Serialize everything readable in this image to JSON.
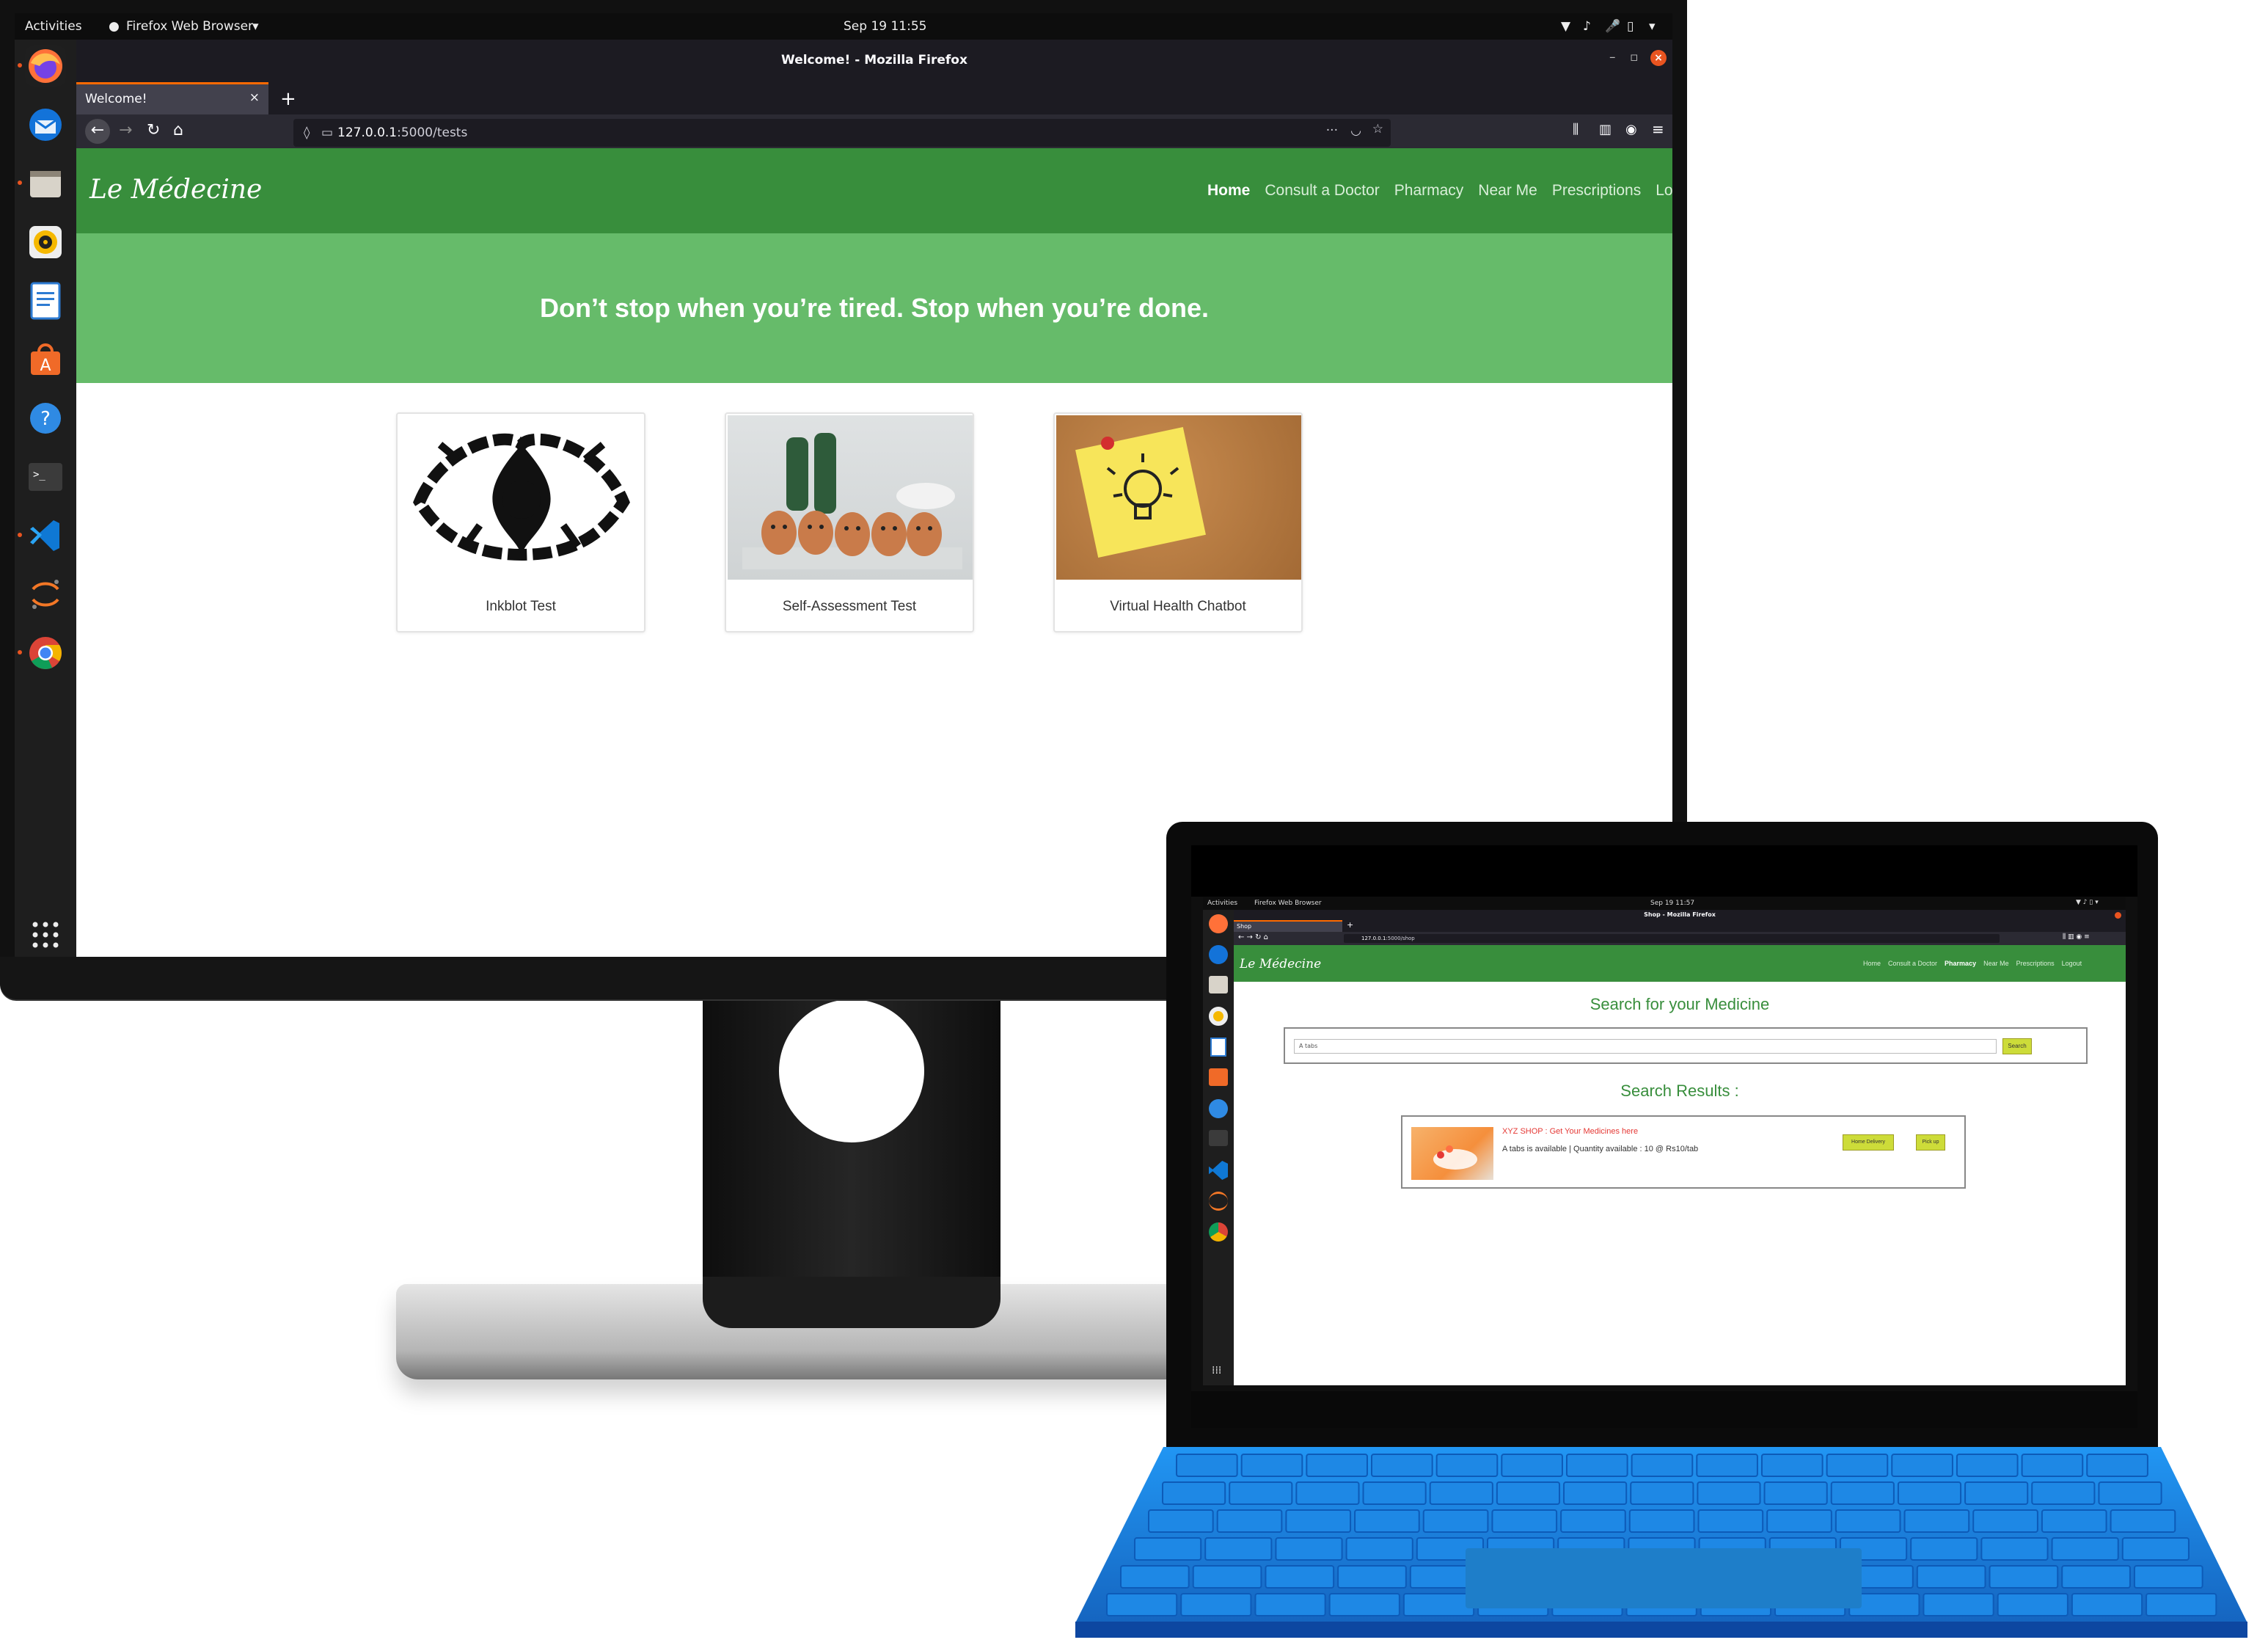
{
  "desktop": {
    "activities": "Activities",
    "app_menu": "Firefox Web Browser",
    "clock": "Sep 19  11:55",
    "window_title": "Welcome! - Mozilla Firefox",
    "tab_title": "Welcome!",
    "url_host": "127.0.0.1",
    "url_path": ":5000/tests",
    "dock": [
      "firefox-icon",
      "thunderbird-icon",
      "files-icon",
      "rhythmbox-icon",
      "writer-icon",
      "software-icon",
      "help-icon",
      "terminal-icon",
      "vscode-icon",
      "jupyter-icon",
      "chrome-icon"
    ]
  },
  "site": {
    "logo": "Le Médecine",
    "nav": [
      "Home",
      "Consult a Doctor",
      "Pharmacy",
      "Near Me",
      "Prescriptions",
      "Logout"
    ],
    "hero": "Don’t stop when you’re tired. Stop when you’re done.",
    "cards": [
      "Inkblot Test",
      "Self-Assessment Test",
      "Virtual Health Chatbot"
    ]
  },
  "laptop": {
    "activities": "Activities",
    "app_menu": "Firefox Web Browser",
    "clock": "Sep 19  11:57",
    "window_title": "Shop - Mozilla Firefox",
    "tab_title": "Shop",
    "url_host": "127.0.0.1",
    "url_path": ":5000/shop",
    "search_heading": "Search for your Medicine",
    "search_value": "A tabs",
    "search_button": "Search",
    "results_heading": "Search Results :",
    "result_shop": "XYZ SHOP : Get Your Medicines here",
    "result_desc": "A tabs is available | Quantity available : 10 @ Rs10/tab",
    "home_delivery": "Home Delivery",
    "pick_up": "Pick up"
  },
  "colors": {
    "navbar": "#388e3c",
    "hero": "#66bb6a",
    "firefox_chrome": "#1c1b22",
    "ubuntu_accent": "#e95420",
    "keyboard": "#1e88e5"
  }
}
